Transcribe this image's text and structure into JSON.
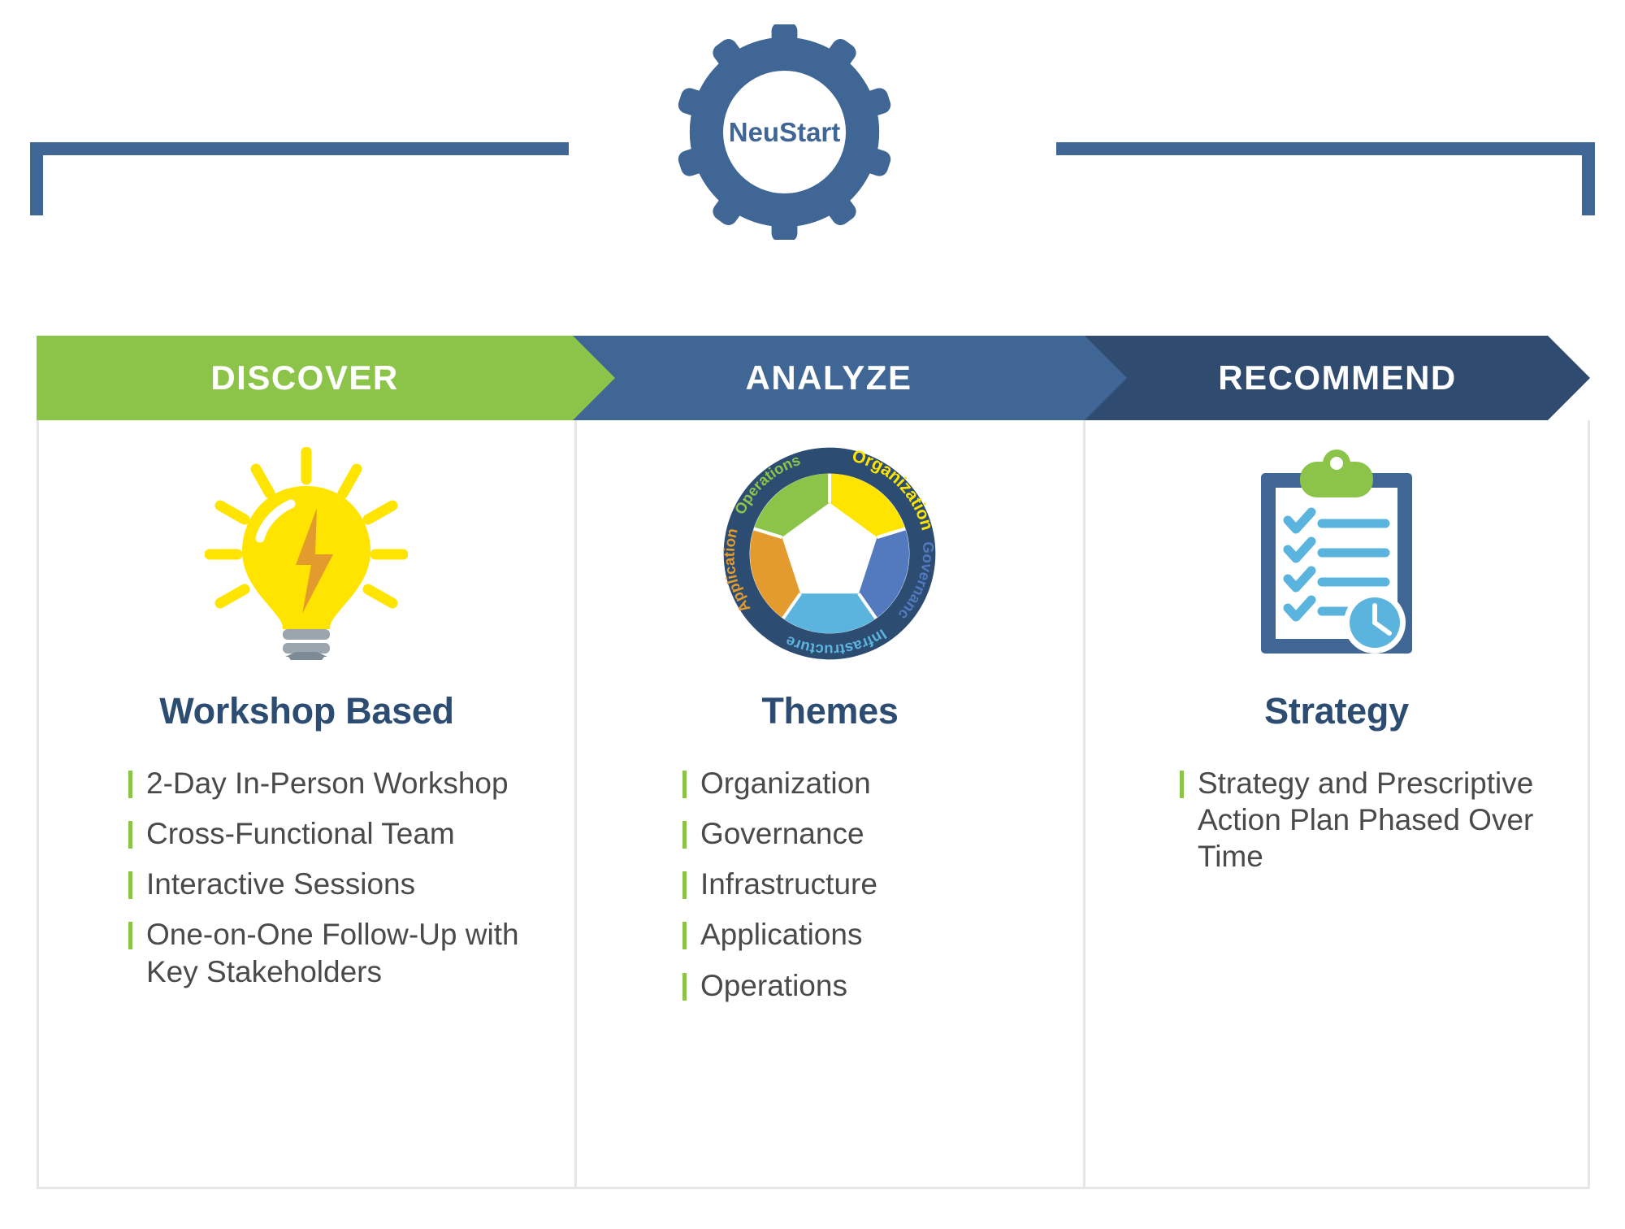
{
  "brand": {
    "logo_text": "NeuStart",
    "logo_icon": "gear-icon"
  },
  "colors": {
    "green": "#8CC449",
    "blue_mid": "#3F6695",
    "blue_dark": "#2F4C70",
    "title_blue": "#2C4C72",
    "body_gray": "#4A4A4A",
    "yellow": "#FFE400",
    "orange": "#E49B2E",
    "light_blue": "#5BB4DE",
    "wheel_blue": "#5379BE",
    "card_border": "#E5E6E8"
  },
  "banner": {
    "steps": [
      {
        "label": "DISCOVER",
        "color": "#8CC449"
      },
      {
        "label": "ANALYZE",
        "color": "#3F6695"
      },
      {
        "label": "RECOMMEND",
        "color": "#2F4C70"
      }
    ]
  },
  "columns": [
    {
      "id": "discover",
      "icon": "lightbulb-icon",
      "title": "Workshop Based",
      "bullets": [
        "2-Day In-Person Workshop",
        "Cross-Functional Team",
        "Interactive Sessions",
        "One-on-One Follow-Up with Key Stakeholders"
      ]
    },
    {
      "id": "analyze",
      "icon": "themes-wheel-icon",
      "title": "Themes",
      "bullets": [
        "Organization",
        "Governance",
        "Infrastructure",
        "Applications",
        "Operations"
      ]
    },
    {
      "id": "recommend",
      "icon": "clipboard-checklist-clock-icon",
      "title": "Strategy",
      "bullets": [
        "Strategy and Prescriptive Action Plan Phased Over Time"
      ]
    }
  ],
  "wheel": {
    "segments": [
      {
        "label": "Organization",
        "color": "#FFE400"
      },
      {
        "label": "Governance",
        "color": "#5379BE"
      },
      {
        "label": "Infrastructure",
        "color": "#5BB4DE"
      },
      {
        "label": "Applications",
        "color": "#E49B2E"
      },
      {
        "label": "Operations",
        "color": "#8CC449"
      }
    ],
    "ring_color": "#2C4C72"
  }
}
